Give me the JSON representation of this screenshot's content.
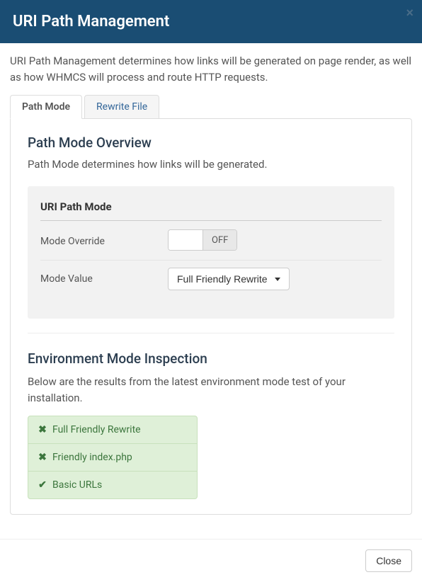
{
  "header": {
    "title": "URI Path Management"
  },
  "description": "URI Path Management determines how links will be generated on page render, as well as how WHMCS will process and route HTTP requests.",
  "tabs": [
    {
      "label": "Path Mode",
      "active": true
    },
    {
      "label": "Rewrite File",
      "active": false
    }
  ],
  "pathMode": {
    "title": "Path Mode Overview",
    "description": "Path Mode determines how links will be generated.",
    "settings": {
      "heading": "URI Path Mode",
      "override": {
        "label": "Mode Override",
        "state": "OFF"
      },
      "value": {
        "label": "Mode Value",
        "selected": "Full Friendly Rewrite"
      }
    }
  },
  "environment": {
    "title": "Environment Mode Inspection",
    "description": "Below are the results from the latest environment mode test of your installation.",
    "results": [
      {
        "label": "Full Friendly Rewrite",
        "status": "fail"
      },
      {
        "label": "Friendly index.php",
        "status": "fail"
      },
      {
        "label": "Basic URLs",
        "status": "pass"
      }
    ]
  },
  "footer": {
    "close": "Close"
  }
}
